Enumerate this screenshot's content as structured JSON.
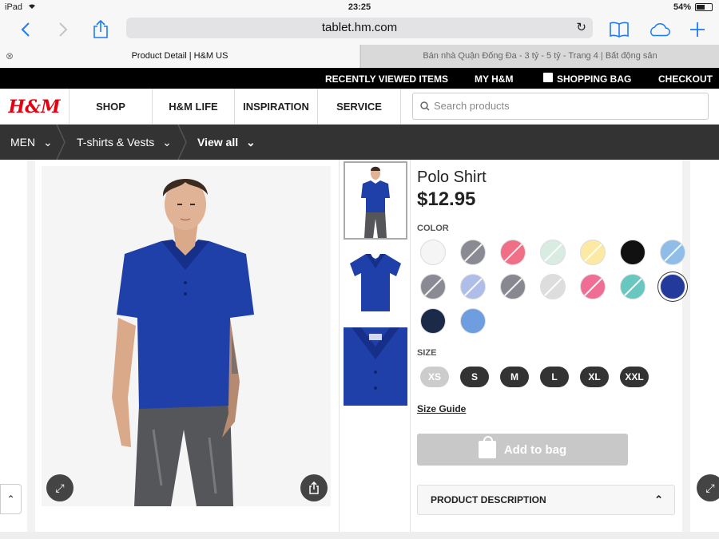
{
  "status": {
    "device": "iPad",
    "time": "23:25",
    "battery": "54%"
  },
  "browser": {
    "url": "tablet.hm.com",
    "tabs": [
      {
        "title": "Product Detail | H&M US"
      },
      {
        "title": "Bán nhà Quận Đống Đa - 3 tỷ - 5 tỷ - Trang 4 | Bất động sản"
      }
    ]
  },
  "site": {
    "top_links": [
      "RECENTLY VIEWED ITEMS",
      "MY H&M",
      "SHOPPING BAG",
      "CHECKOUT"
    ],
    "logo": "H&M",
    "nav": [
      "SHOP",
      "H&M LIFE",
      "INSPIRATION",
      "SERVICE"
    ],
    "search_placeholder": "Search products",
    "breadcrumbs": [
      "MEN",
      "T-shirts & Vests",
      "View all"
    ]
  },
  "product": {
    "name": "Polo Shirt",
    "price": "$12.95",
    "color_label": "COLOR",
    "colors": [
      "#f5f5f5",
      "#8a8a94",
      "#f06e86",
      "#d9ece2",
      "#fbe9a4",
      "#111111",
      "#8fbde8",
      "#8a8a94",
      "#aebee8",
      "#888890",
      "#dddddd",
      "#f06e96",
      "#68c8c0",
      "#23399b",
      "#1c2a4a",
      "#6f9ee0"
    ],
    "size_label": "SIZE",
    "sizes": [
      "XS",
      "S",
      "M",
      "L",
      "XL",
      "XXL"
    ],
    "size_guide": "Size Guide",
    "add_to_bag": "Add to bag",
    "description_label": "PRODUCT DESCRIPTION",
    "shirt_color": "#1f3fa9"
  }
}
